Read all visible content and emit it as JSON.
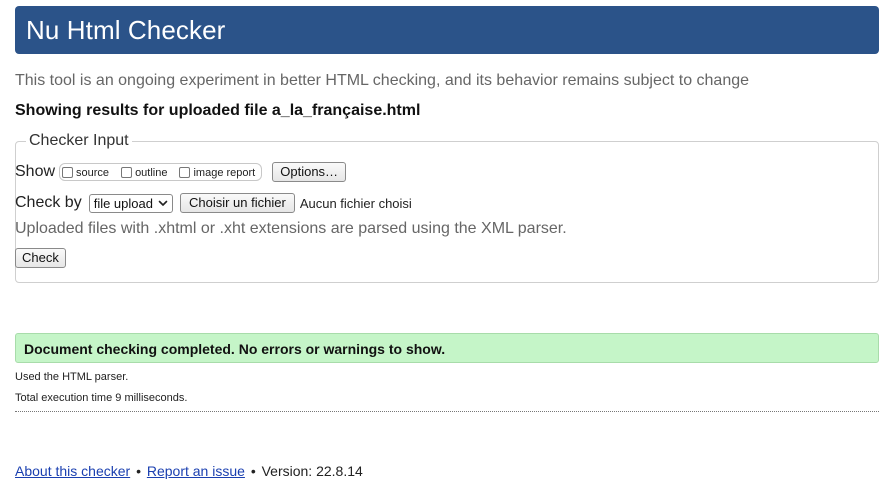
{
  "header": {
    "title": "Nu Html Checker",
    "background_color": "#2b5389"
  },
  "tagline": "This tool is an ongoing experiment in better HTML checking, and its behavior remains subject to change",
  "results_title": "Showing results for uploaded file a_la_française.html",
  "checker_input": {
    "legend": "Checker Input",
    "show_label": "Show",
    "show_options": [
      {
        "label": "source",
        "checked": false
      },
      {
        "label": "outline",
        "checked": false
      },
      {
        "label": "image report",
        "checked": false
      }
    ],
    "options_button": "Options…",
    "check_by_label": "Check by",
    "check_by_selected": "file upload",
    "choose_file_button": "Choisir un fichier",
    "file_status": "Aucun fichier choisi",
    "note": "Uploaded files with .xhtml or .xht extensions are parsed using the XML parser.",
    "check_button": "Check"
  },
  "result": {
    "message": "Document checking completed. No errors or warnings to show.",
    "background_color": "#c5f5c8"
  },
  "stats": {
    "parser": "Used the HTML parser.",
    "time": "Total execution time 9 milliseconds."
  },
  "footer": {
    "about_link": "About this checker",
    "separator": "•",
    "report_link": "Report an issue",
    "version": "Version: 22.8.14",
    "link_color": "#1a3fb0"
  }
}
